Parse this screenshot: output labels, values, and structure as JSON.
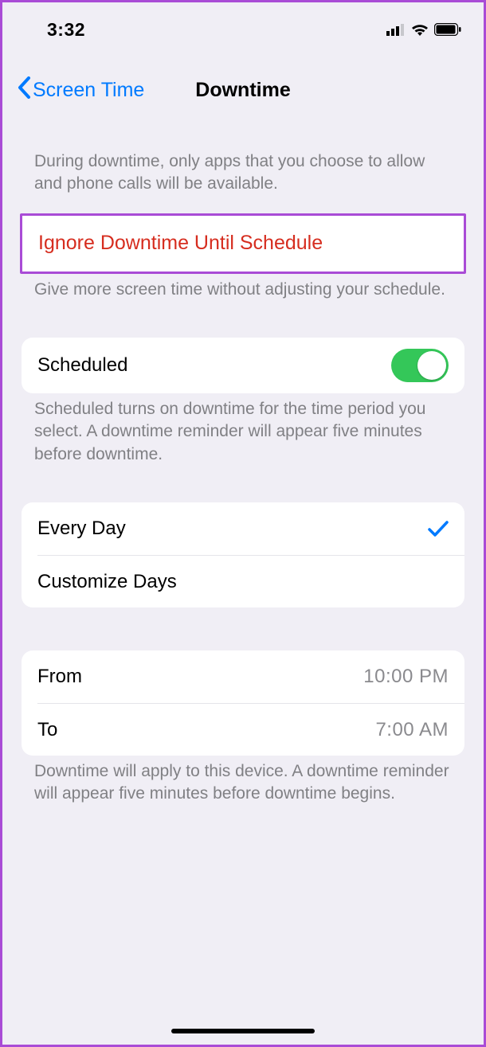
{
  "status": {
    "time": "3:32"
  },
  "nav": {
    "back_label": "Screen Time",
    "title": "Downtime"
  },
  "intro_desc": "During downtime, only apps that you choose to allow and phone calls will be available.",
  "ignore": {
    "label": "Ignore Downtime Until Schedule",
    "desc": "Give more screen time without adjusting your schedule."
  },
  "scheduled": {
    "label": "Scheduled",
    "on": true,
    "desc": "Scheduled turns on downtime for the time period you select. A downtime reminder will appear five minutes before downtime."
  },
  "days": {
    "every_day": "Every Day",
    "customize_days": "Customize Days",
    "selected": "every_day"
  },
  "time": {
    "from_label": "From",
    "from_value": "10:00 PM",
    "to_label": "To",
    "to_value": "7:00 AM",
    "desc": "Downtime will apply to this device. A downtime reminder will appear five minutes before downtime begins."
  }
}
